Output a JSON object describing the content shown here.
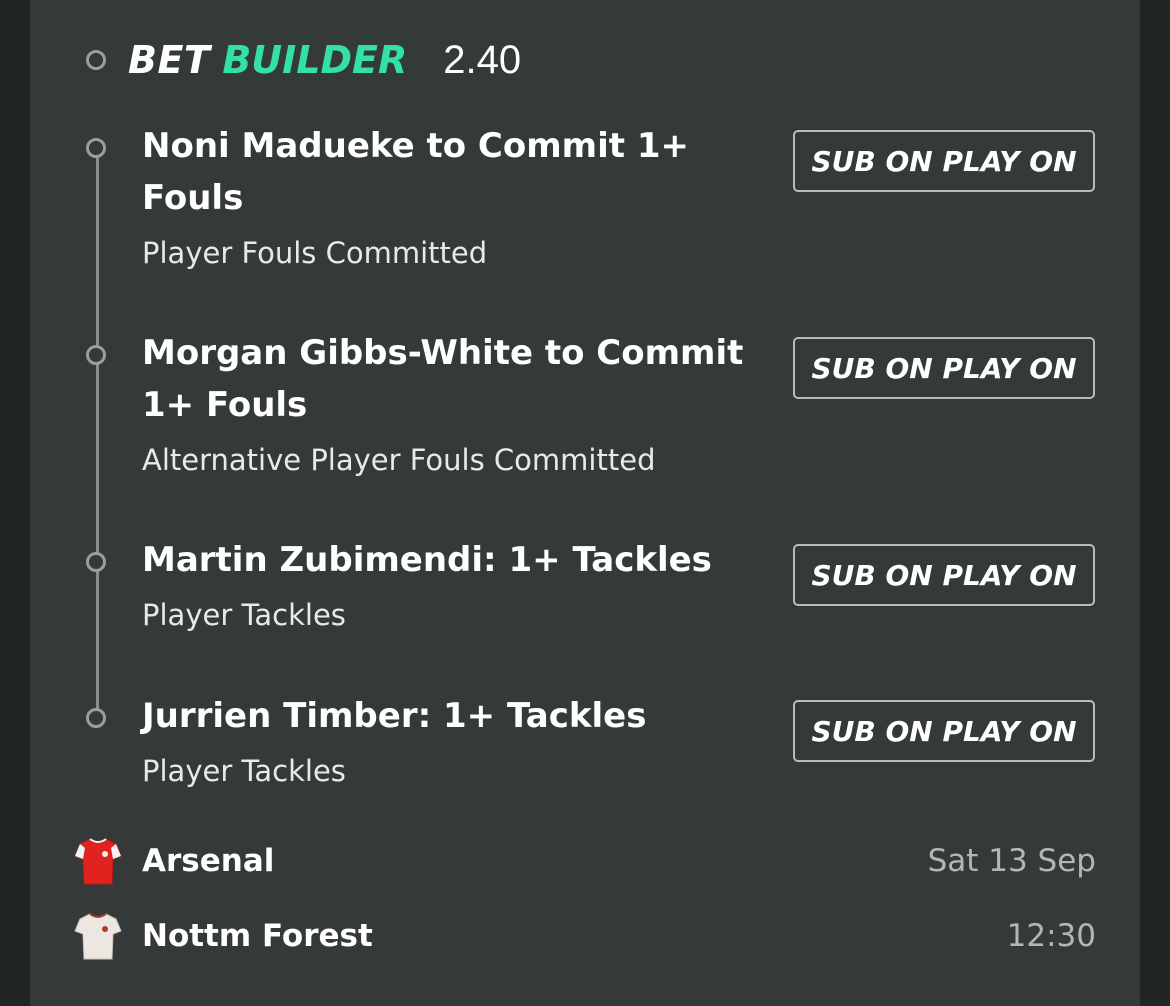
{
  "header": {
    "title_part1": "BET",
    "title_part2": "BUILDER",
    "odds": "2.40"
  },
  "legs": [
    {
      "title": "Noni Madueke to Commit 1+ Fouls",
      "market": "Player Fouls Committed",
      "button": "SUB ON PLAY ON"
    },
    {
      "title": "Morgan Gibbs-White to Commit 1+ Fouls",
      "market": "Alternative Player Fouls Committed",
      "button": "SUB ON PLAY ON"
    },
    {
      "title": "Martin Zubimendi: 1+ Tackles",
      "market": "Player Tackles",
      "button": "SUB ON PLAY ON"
    },
    {
      "title": "Jurrien Timber: 1+ Tackles",
      "market": "Player Tackles",
      "button": "SUB ON PLAY ON"
    }
  ],
  "match": {
    "home": {
      "name": "Arsenal",
      "shirt_icon": "red-shirt-icon",
      "meta": "Sat 13 Sep"
    },
    "away": {
      "name": "Nottm Forest",
      "shirt_icon": "white-shirt-icon",
      "meta": "12:30"
    }
  },
  "colors": {
    "background": "#343a39",
    "accent": "#33e0a6",
    "home_shirt": "#e0231e",
    "away_shirt": "#ece7e1"
  }
}
